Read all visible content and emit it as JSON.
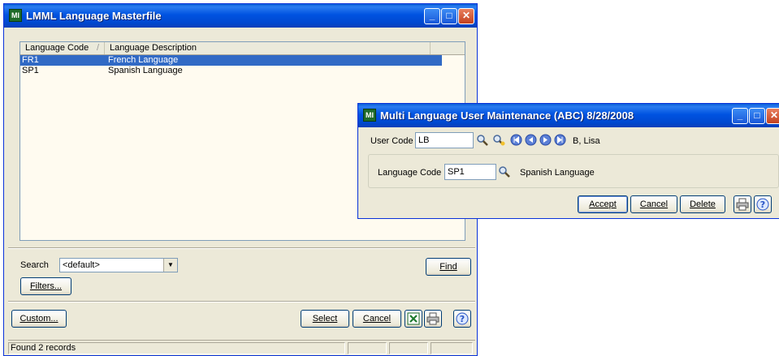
{
  "masterfile": {
    "title": "LMML Language Masterfile",
    "app_icon_text": "MI",
    "columns": [
      "Language Code",
      "Language Description"
    ],
    "sort_indicator": "/",
    "rows": [
      {
        "code": "FR1",
        "description": "French Language",
        "selected": true
      },
      {
        "code": "SP1",
        "description": "Spanish Language",
        "selected": false
      }
    ],
    "search_label": "Search",
    "search_value": "<default>",
    "find_label": "Find",
    "filters_label": "Filters...",
    "custom_label": "Custom...",
    "select_label": "Select",
    "cancel_label": "Cancel",
    "status_text": "Found 2 records"
  },
  "user_maint": {
    "title": "Multi Language User Maintenance (ABC) 8/28/2008",
    "app_icon_text": "MI",
    "user_code_label": "User Code",
    "user_code_value": "LB",
    "user_name": "B, Lisa",
    "language_code_label": "Language Code",
    "language_code_value": "SP1",
    "language_desc": "Spanish Language",
    "accept_label": "Accept",
    "cancel_label": "Cancel",
    "delete_label": "Delete"
  },
  "icons": [
    "minimize-icon",
    "maximize-icon",
    "close-icon",
    "lookup-icon",
    "search-plus-icon",
    "first-record-icon",
    "prev-record-icon",
    "next-record-icon",
    "last-record-icon",
    "excel-icon",
    "print-icon",
    "help-icon",
    "dropdown-arrow-icon"
  ],
  "colors": {
    "titlebar": "#0053e1",
    "selection": "#316ac5",
    "window_bg": "#ece9d8",
    "grid_bg": "#fffbf0"
  }
}
